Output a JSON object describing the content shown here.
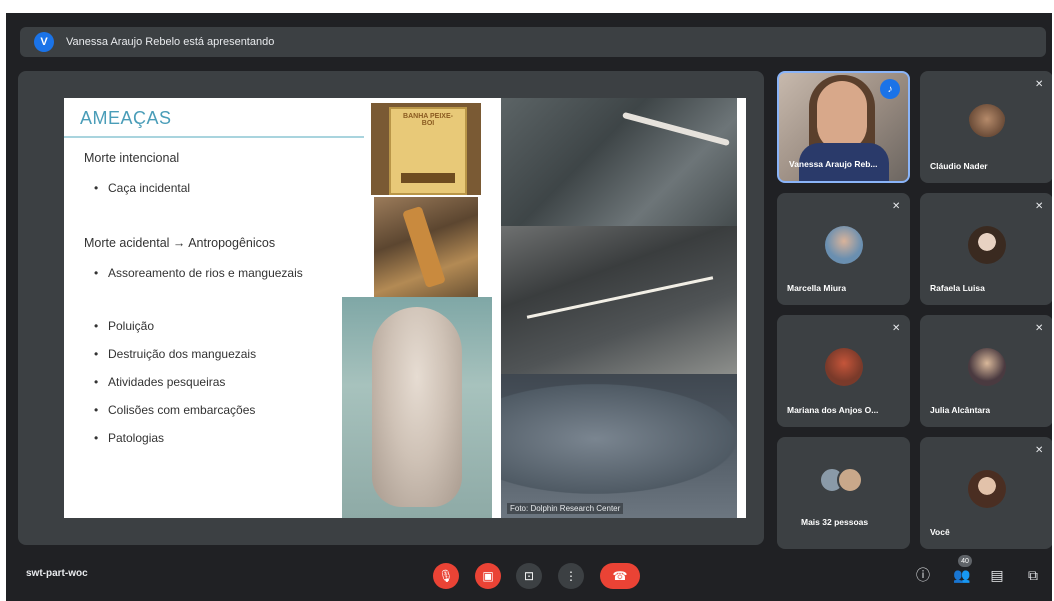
{
  "banner": {
    "avatar_letter": "V",
    "text": "Vanessa Araujo Rebelo está apresentando"
  },
  "slide": {
    "title": "AMEAÇAS",
    "heading1": "Morte intencional",
    "bullets1": [
      "Caça incidental"
    ],
    "heading2": "Morte acidental → Antropogênicos",
    "bullets2": [
      "Assoreamento de rios e manguezais",
      "Poluição",
      "Destruição dos manguezais",
      "Atividades pesqueiras",
      "Colisões com embarcações",
      "Patologias"
    ],
    "photo_caption": "Foto: Dolphin Research Center",
    "book_text": "BANHA PEIXE-BOI"
  },
  "participants": [
    {
      "name": "Vanessa Araujo Reb...",
      "speaking": true
    },
    {
      "name": "Cláudio Nader"
    },
    {
      "name": "Marcella Miura"
    },
    {
      "name": "Rafaela Luisa"
    },
    {
      "name": "Mariana dos Anjos O..."
    },
    {
      "name": "Julia Alcântara"
    },
    {
      "name": "Mais 32 pessoas"
    },
    {
      "name": "Você"
    }
  ],
  "meeting": {
    "code": "swt-part-woc",
    "people_count": "40"
  },
  "icons": {
    "mic": "mic-off-icon",
    "camera": "camera-off-icon",
    "present": "present-screen-icon",
    "more": "more-vert-icon",
    "hangup": "call-end-icon",
    "info": "info-icon",
    "people": "people-icon",
    "chat": "chat-icon",
    "activities": "activities-icon"
  },
  "colors": {
    "background": "#202124",
    "tile": "#3c4043",
    "red": "#ea4335",
    "accent": "#1a73e8",
    "slide_title": "#4a9db8"
  }
}
